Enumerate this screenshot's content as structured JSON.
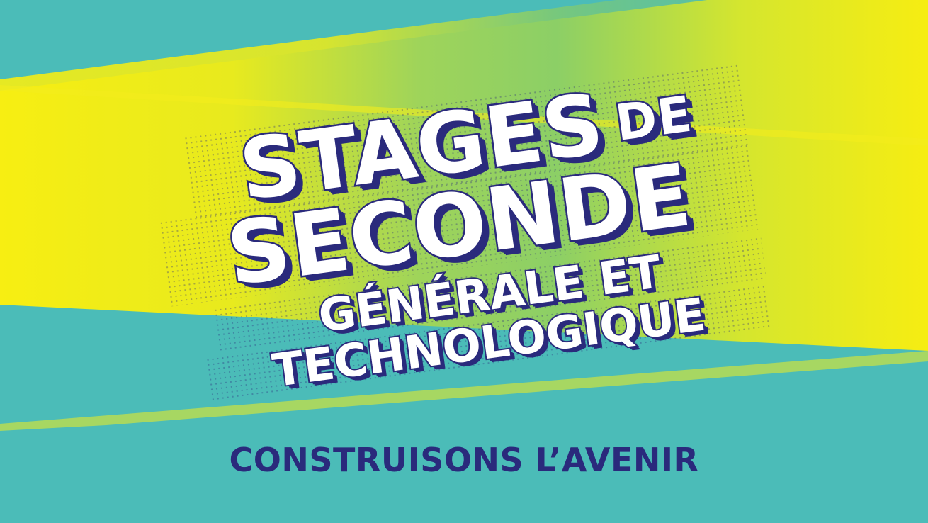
{
  "headline": {
    "line1_big": "STAGES",
    "line1_small": "DE",
    "line2": "SECONDE",
    "line3": "GÉNÉRALE ET",
    "line4": "TECHNOLOGIQUE"
  },
  "tagline": "CONSTRUISONS L’AVENIR",
  "colors": {
    "background_teal": "#4bbcb8",
    "band_yellow": "#f4ec1c",
    "band_green": "#a6d657",
    "text_navy": "#2a2a7c",
    "text_white": "#ffffff"
  }
}
